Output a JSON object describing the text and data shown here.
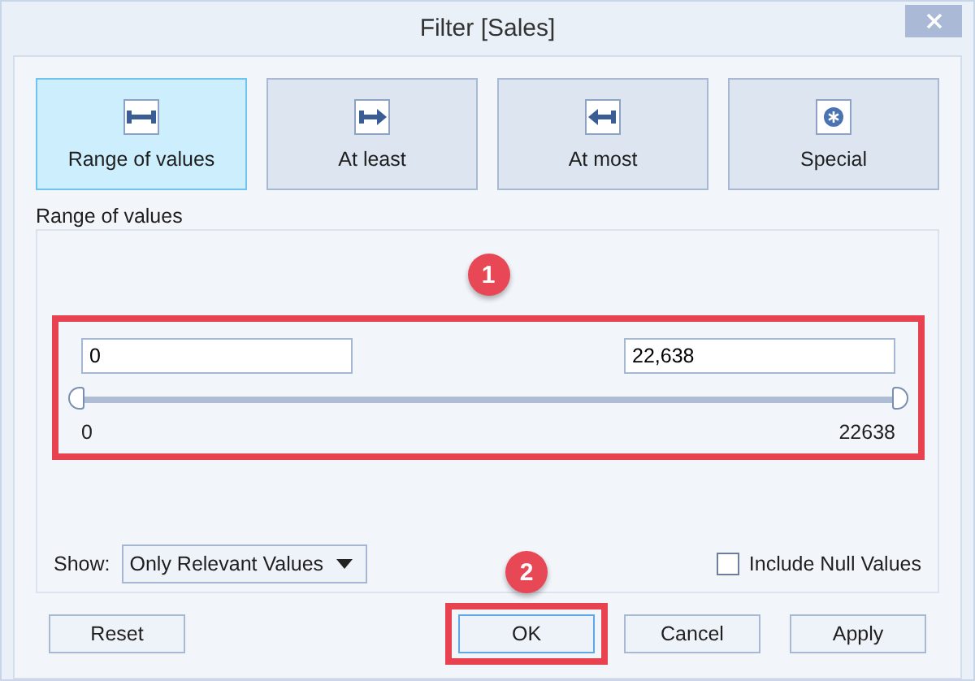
{
  "window": {
    "title": "Filter [Sales]"
  },
  "tabs": [
    {
      "label": "Range of values",
      "kind": "range",
      "selected": true
    },
    {
      "label": "At least",
      "kind": "atleast",
      "selected": false
    },
    {
      "label": "At most",
      "kind": "atmost",
      "selected": false
    },
    {
      "label": "Special",
      "kind": "special",
      "selected": false
    }
  ],
  "group_label": "Range of values",
  "range": {
    "min_value": "0",
    "max_value": "22,638",
    "thumbs": [
      {
        "level": 0
      },
      {
        "level": 1
      }
    ],
    "min_label": "0",
    "max_label": "22638"
  },
  "show": {
    "label": "Show:",
    "value": "Only Relevant Values"
  },
  "include_null": {
    "label": "Include Null Values",
    "checked": false
  },
  "buttons": [
    {
      "label": "Reset",
      "highlighted": false
    },
    {
      "label": "OK",
      "highlighted": true
    },
    {
      "label": "Cancel",
      "highlighted": false
    },
    {
      "label": "Apply",
      "highlighted": false
    }
  ],
  "callouts": [
    "1",
    "2"
  ]
}
